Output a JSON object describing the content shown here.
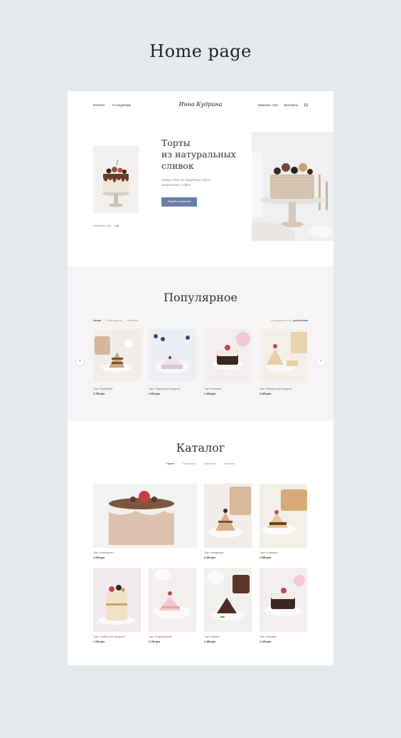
{
  "presentation_title": "Home page",
  "header": {
    "nav_left": [
      "Каталог",
      "О кондитере"
    ],
    "logo": "Инна Кудрина",
    "nav_right": [
      "Заказать торт",
      "Контакты"
    ]
  },
  "hero": {
    "title_lines": [
      "Торты",
      "из натуральных",
      "сливок"
    ],
    "subtitle": "Скидка 20% на свадебные торты заказанные с сайта",
    "button": "Перейти в каталог",
    "order_link": "Заказать торт"
  },
  "popular": {
    "title": "Популярное",
    "tabs": [
      "Акции",
      "Популярное",
      "Новинки"
    ],
    "sort_label": "Сортировать по:",
    "sort_value": "умолчанию",
    "items": [
      {
        "name": "Торт «Киевский»",
        "price": "1 750 р/кг"
      },
      {
        "name": "Торт «Черничное ассорти»",
        "price": "1 200 р/кг"
      },
      {
        "name": "Торт «Ночник»",
        "price": "1 200 р/кг"
      },
      {
        "name": "Торт «Воскресное ассорти»",
        "price": "1 200 р/кг"
      }
    ]
  },
  "catalog": {
    "title": "Каталог",
    "tabs": [
      "Торты",
      "Пирожные",
      "Капкейки",
      "Пряники"
    ],
    "items": [
      {
        "name": "Торт «Наполеон»",
        "price": "1 200 р/кг"
      },
      {
        "name": "Торт «Киевский»",
        "price": "2 200 р/кг"
      },
      {
        "name": "Торт «Сникерс»",
        "price": "1 950 р/кг"
      },
      {
        "name": "Торт «Субботнее ассорти»",
        "price": "1 200 р/кг"
      },
      {
        "name": "Торт «Клубничный»",
        "price": "1 700 р/кг"
      },
      {
        "name": "Торт «Прага»",
        "price": "1 450 р/кг"
      },
      {
        "name": "Торт «Ночник»",
        "price": "1 200 р/кг"
      }
    ]
  },
  "colors": {
    "background": "#e6e9ee",
    "accent_button": "#6b7fa6",
    "section_bg": "#f6f4f6"
  }
}
